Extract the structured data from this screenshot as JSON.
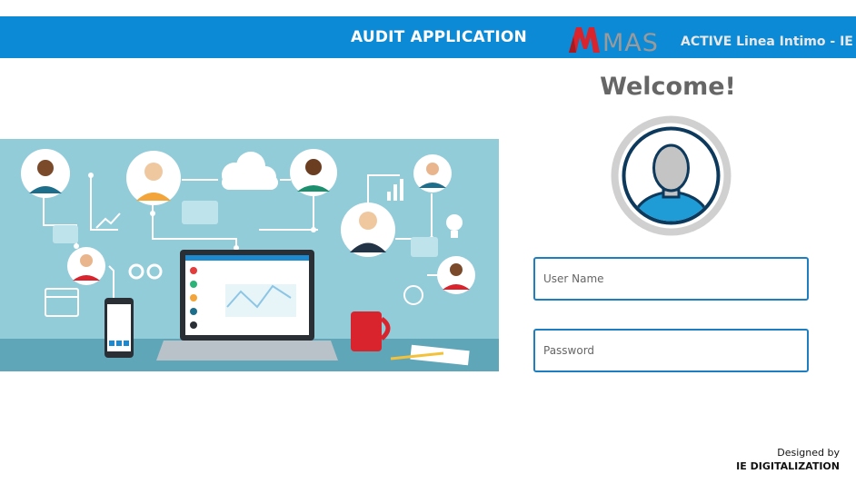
{
  "header": {
    "title": "AUDIT APPLICATION",
    "brand_logo_text": "MAS",
    "brand_subtitle": "ACTIVE Linea Intimo - IE"
  },
  "login": {
    "welcome": "Welcome!",
    "username_placeholder": "User Name",
    "password_placeholder": "Password"
  },
  "footer": {
    "designed_by": "Designed by",
    "organization": "IE DIGITALIZATION"
  },
  "colors": {
    "header_bg": "#0d8ad6",
    "field_border": "#1d7ec2",
    "brand_red": "#d9232d"
  },
  "icons": [
    "user-avatar-icon",
    "mas-logo-icon"
  ]
}
